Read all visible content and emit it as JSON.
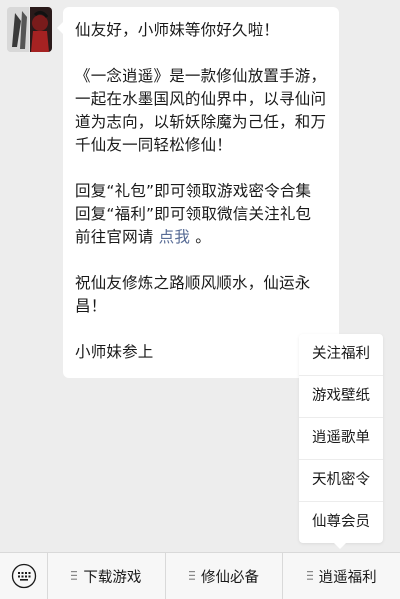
{
  "chat": {
    "avatar_icon": "game-avatar-icon",
    "message": {
      "greeting": "仙友好，小师妹等你好久啦！",
      "intro": "《一念逍遥》是一款修仙放置手游，一起在水墨国风的仙界中，以寻仙问道为志向，以斩妖除魔为己任，和万千仙友一同轻松修仙！",
      "reply_gift": "回复“礼包”即可领取游戏密令合集",
      "reply_welfare": "回复“福利”即可领取微信关注礼包",
      "website_prefix": "前往官网请",
      "website_link": "点我",
      "website_suffix": "。",
      "wish": "祝仙友修炼之路顺风顺水，仙运永昌！",
      "signature": "小师妹参上"
    }
  },
  "submenu": {
    "items": [
      "关注福利",
      "游戏壁纸",
      "逍遥歌单",
      "天机密令",
      "仙尊会员"
    ]
  },
  "bottom_bar": {
    "keyboard_icon": "keyboard-icon",
    "tabs": [
      {
        "label": "下载游戏"
      },
      {
        "label": "修仙必备"
      },
      {
        "label": "逍遥福利"
      }
    ]
  },
  "colors": {
    "background": "#ededed",
    "bubble": "#ffffff",
    "link": "#576b95",
    "bar": "#f7f7f7"
  }
}
